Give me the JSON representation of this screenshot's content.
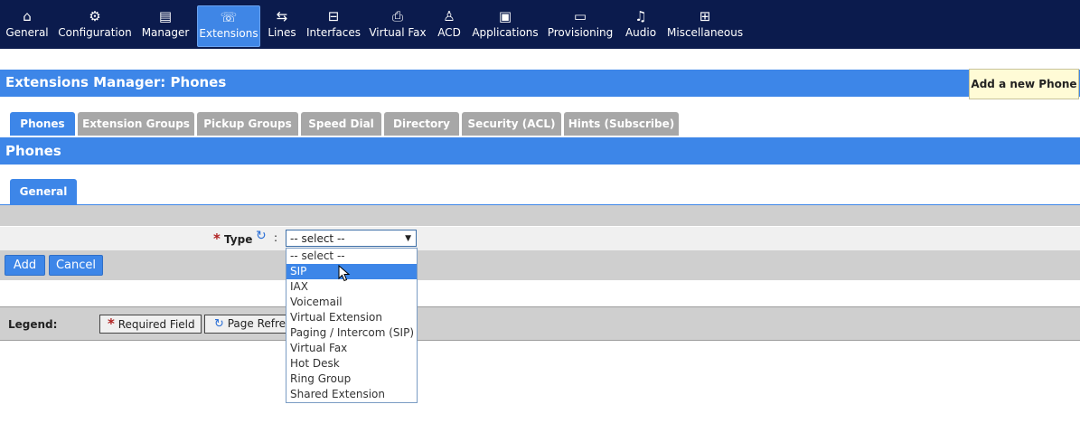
{
  "nav": {
    "items": [
      {
        "label": "General",
        "icon": "home-icon",
        "glyph": "⌂"
      },
      {
        "label": "Configuration",
        "icon": "gear-icon",
        "glyph": "⚙"
      },
      {
        "label": "Manager",
        "icon": "manager-icon",
        "glyph": "▤"
      },
      {
        "label": "Extensions",
        "icon": "phone-icon",
        "glyph": "☏"
      },
      {
        "label": "Lines",
        "icon": "lines-icon",
        "glyph": "⇆"
      },
      {
        "label": "Interfaces",
        "icon": "interfaces-icon",
        "glyph": "⊟"
      },
      {
        "label": "Virtual Fax",
        "icon": "fax-icon",
        "glyph": "⎙"
      },
      {
        "label": "ACD",
        "icon": "agent-icon",
        "glyph": "♙"
      },
      {
        "label": "Applications",
        "icon": "applications-icon",
        "glyph": "▣"
      },
      {
        "label": "Provisioning",
        "icon": "provisioning-icon",
        "glyph": "▭"
      },
      {
        "label": "Audio",
        "icon": "music-icon",
        "glyph": "♫"
      },
      {
        "label": "Miscellaneous",
        "icon": "misc-icon",
        "glyph": "⊞"
      }
    ]
  },
  "page": {
    "title": "Extensions Manager:  Phones",
    "add_button": "Add a new Phone"
  },
  "tabs": [
    "Phones",
    "Extension Groups",
    "Pickup Groups",
    "Speed Dial",
    "Directory",
    "Security (ACL)",
    "Hints (Subscribe)"
  ],
  "section": {
    "title": "Phones",
    "subtab": "General"
  },
  "form": {
    "required_marker": "*",
    "type_label": "Type",
    "colon": ":",
    "select_value": "-- select --",
    "options": [
      "-- select --",
      "SIP",
      "IAX",
      "Voicemail",
      "Virtual Extension",
      "Paging / Intercom (SIP)",
      "Virtual Fax",
      "Hot Desk",
      "Ring Group",
      "Shared Extension"
    ],
    "highlighted_option": "SIP"
  },
  "buttons": {
    "add": "Add",
    "cancel": "Cancel"
  },
  "legend": {
    "label": "Legend:",
    "required": "Required Field",
    "refresh": "Page Refresh"
  },
  "colors": {
    "nav_bg": "#0b1b4d",
    "accent": "#3d86e8",
    "tab_inactive": "#a7a7a7",
    "required": "#b02020"
  }
}
